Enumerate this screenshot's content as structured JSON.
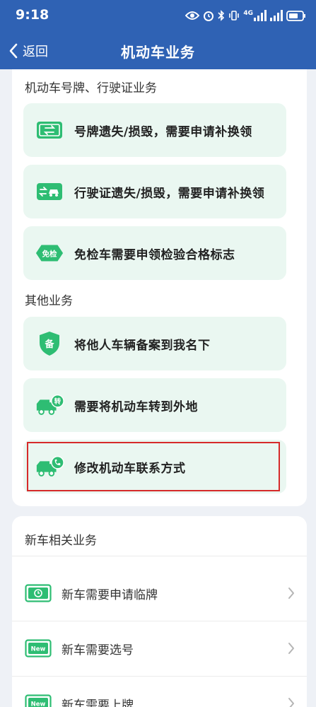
{
  "status_bar": {
    "time": "9:18",
    "network_label": "4G"
  },
  "nav": {
    "back_label": "返回",
    "title": "机动车业务"
  },
  "plate_section": {
    "title": "机动车号牌、行驶证业务",
    "items": [
      {
        "label": "号牌遗失/损毁，需要申请补换领",
        "icon": "license-plate-icon"
      },
      {
        "label": "行驶证遗失/损毁，需要申请补换领",
        "icon": "driving-license-icon"
      },
      {
        "label": "免检车需要申领检验合格标志",
        "icon": "inspection-exempt-icon",
        "badge_text": "免检"
      }
    ]
  },
  "other_section": {
    "title": "其他业务",
    "items": [
      {
        "label": "将他人车辆备案到我名下",
        "icon": "filing-shield-icon",
        "badge_text": "备"
      },
      {
        "label": "需要将机动车转到外地",
        "icon": "truck-transfer-icon",
        "badge_text": "转"
      },
      {
        "label": "修改机动车联系方式",
        "icon": "truck-phone-icon"
      }
    ]
  },
  "new_car_section": {
    "title": "新车相关业务",
    "items": [
      {
        "label": "新车需要申请临牌",
        "icon": "temp-plate-icon"
      },
      {
        "label": "新车需要选号",
        "icon": "new-plate-icon",
        "badge_text": "New"
      },
      {
        "label": "新车需要上牌",
        "icon": "new-plate-icon",
        "badge_text": "New"
      }
    ]
  },
  "colors": {
    "header_bg": "#2f62b4",
    "item_bg": "#eaf7f1",
    "icon_green": "#2ebd73",
    "highlight_border": "#d62a2a"
  }
}
